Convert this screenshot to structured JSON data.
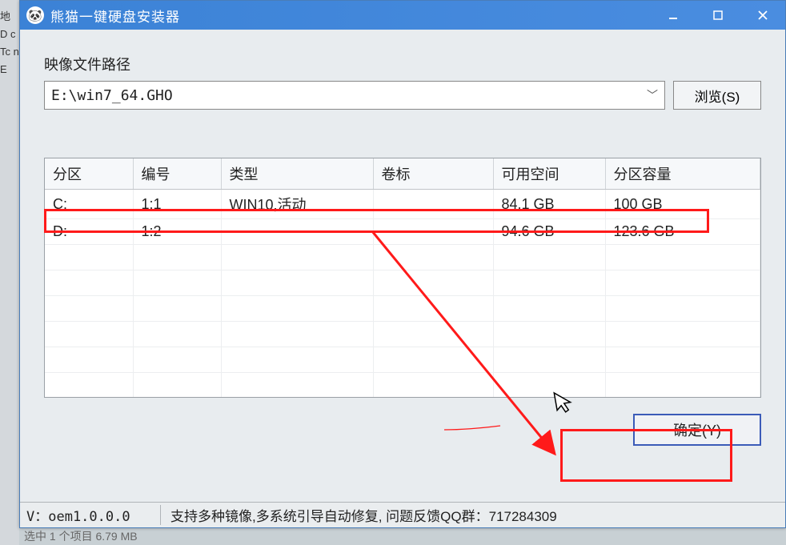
{
  "titlebar": {
    "icon_emoji": "🐼",
    "title": "熊猫一键硬盘安装器"
  },
  "image_path": {
    "label": "映像文件路径",
    "value": "E:\\win7_64.GHO",
    "browse_label": "浏览(S)"
  },
  "table": {
    "headers": {
      "partition": "分区",
      "serial": "编号",
      "type": "类型",
      "label": "卷标",
      "free": "可用空间",
      "size": "分区容量"
    },
    "rows": [
      {
        "partition": "C:",
        "serial": "1:1",
        "type": "WIN10,活动",
        "label": "",
        "free": "84.1 GB",
        "size": "100 GB"
      },
      {
        "partition": "D:",
        "serial": "1:2",
        "type": "",
        "label": "",
        "free": "94.6 GB",
        "size": "123.6 GB"
      }
    ]
  },
  "actions": {
    "ok_label": "确定(Y)"
  },
  "status": {
    "version": "V：oem1.0.0.0",
    "info": "支持多种镜像,多系统引导自动修复, 问题反馈QQ群：717284309"
  },
  "below": "选中 1 个项目  6.79 MB",
  "desktop_edge_chars": "地\nD\nc\nTc\nn\nE"
}
